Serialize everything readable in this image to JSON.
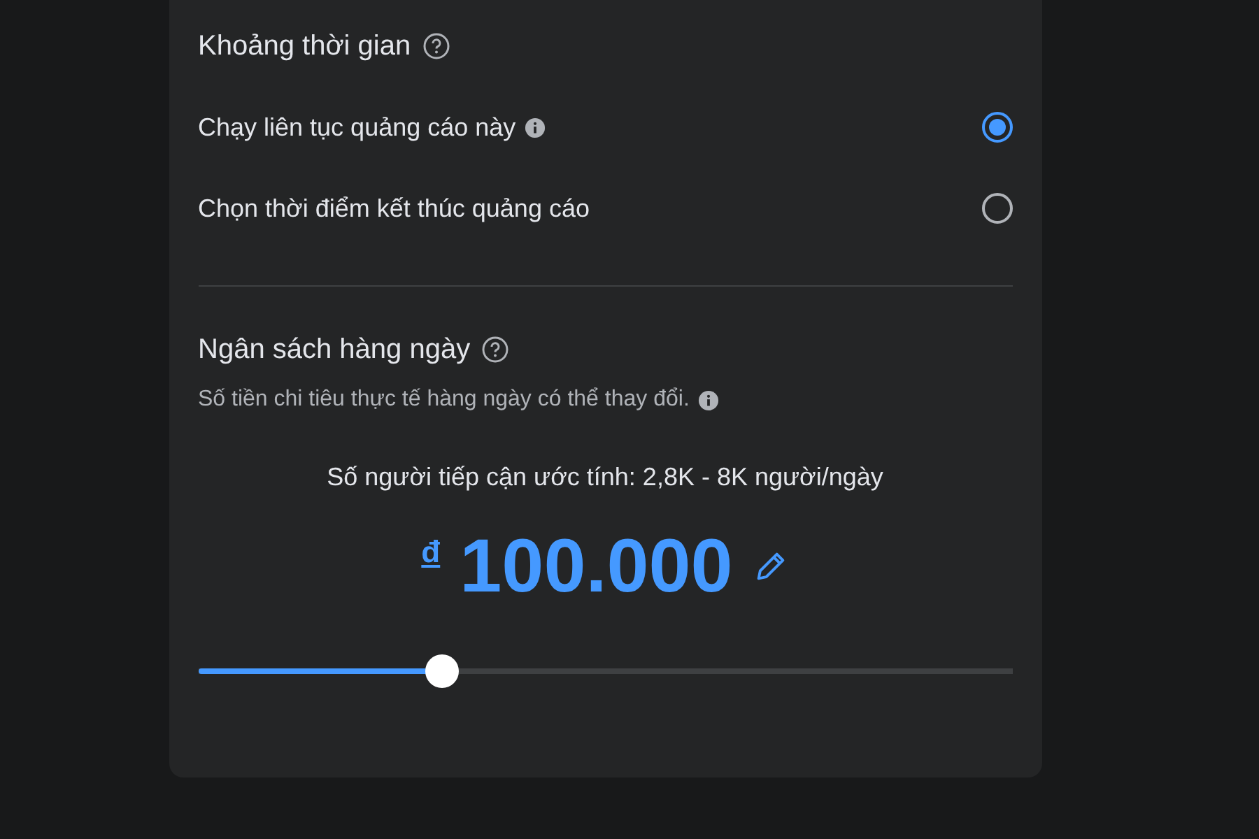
{
  "duration": {
    "title": "Khoảng thời gian",
    "options": [
      {
        "label": "Chạy liên tục quảng cáo này",
        "info": true,
        "selected": true
      },
      {
        "label": "Chọn thời điểm kết thúc quảng cáo",
        "info": false,
        "selected": false
      }
    ]
  },
  "budget": {
    "title": "Ngân sách hàng ngày",
    "note": "Số tiền chi tiêu thực tế hàng ngày có thể thay đổi.",
    "reach": "Số người tiếp cận ước tính: 2,8K - 8K người/ngày",
    "currency": "đ",
    "amount": "100.000",
    "level": 0.3
  }
}
